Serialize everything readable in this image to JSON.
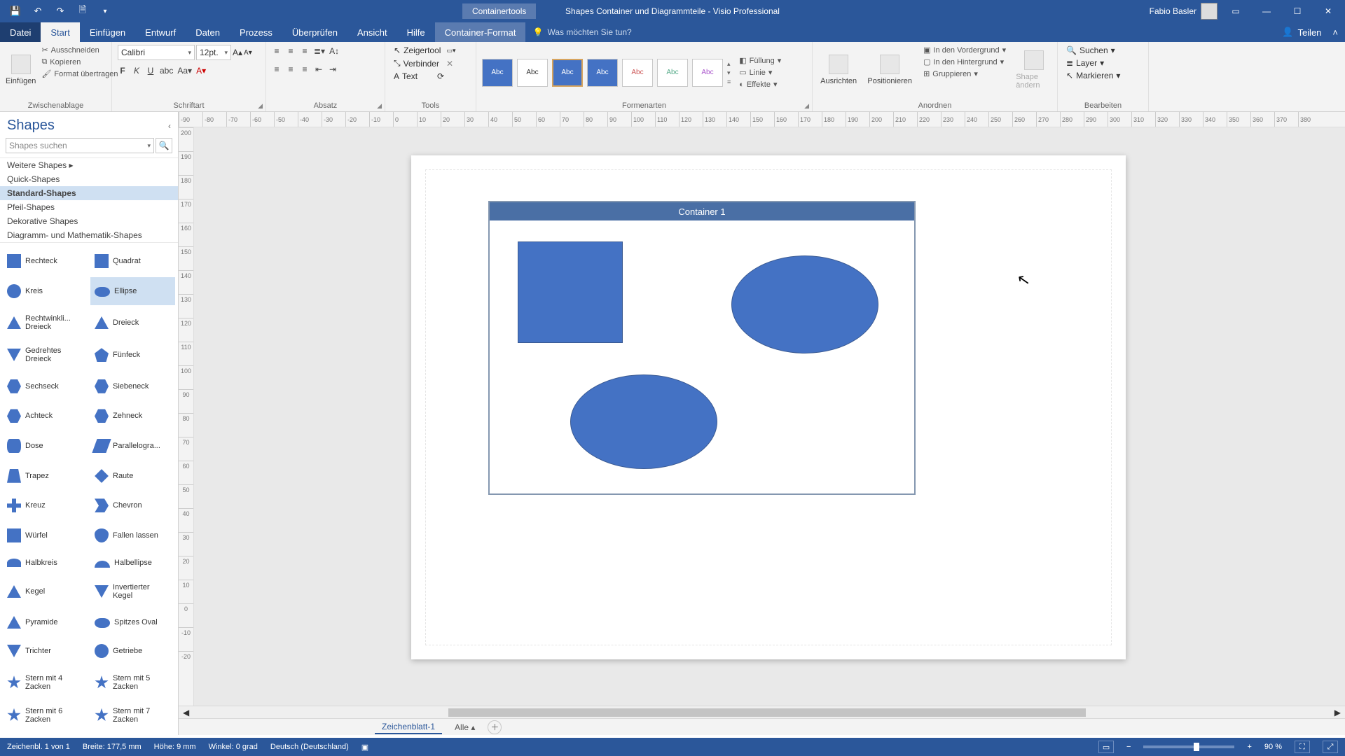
{
  "titlebar": {
    "context_tab": "Containertools",
    "doc_title": "Shapes Container und Diagrammteile  -  Visio Professional",
    "user_name": "Fabio Basler"
  },
  "tabs": {
    "datei": "Datei",
    "start": "Start",
    "einfuegen": "Einfügen",
    "entwurf": "Entwurf",
    "daten": "Daten",
    "prozess": "Prozess",
    "ueberpruefen": "Überprüfen",
    "ansicht": "Ansicht",
    "hilfe": "Hilfe",
    "container_format": "Container-Format",
    "tellme": "Was möchten Sie tun?",
    "teilen": "Teilen"
  },
  "ribbon": {
    "zwischenablage": {
      "einfuegen": "Einfügen",
      "ausschneiden": "Ausschneiden",
      "kopieren": "Kopieren",
      "format_uebertragen": "Format übertragen",
      "label": "Zwischenablage"
    },
    "schriftart": {
      "font": "Calibri",
      "size": "12pt.",
      "label": "Schriftart"
    },
    "absatz": {
      "label": "Absatz"
    },
    "tools": {
      "zeigertool": "Zeigertool",
      "verbinder": "Verbinder",
      "text": "Text",
      "label": "Tools"
    },
    "formenarten": {
      "sample": "Abc",
      "fuellung": "Füllung",
      "linie": "Linie",
      "effekte": "Effekte",
      "label": "Formenarten"
    },
    "anordnen": {
      "ausrichten": "Ausrichten",
      "positionieren": "Positionieren",
      "vordergrund": "In den Vordergrund",
      "hintergrund": "In den Hintergrund",
      "gruppieren": "Gruppieren",
      "shape_aendern": "Shape ändern",
      "layer": "Layer",
      "label": "Anordnen"
    },
    "bearbeiten": {
      "suchen": "Suchen",
      "markieren": "Markieren",
      "label": "Bearbeiten"
    }
  },
  "shapes_pane": {
    "title": "Shapes",
    "search_placeholder": "Shapes suchen",
    "categories": {
      "weitere": "Weitere Shapes",
      "quick": "Quick-Shapes",
      "standard": "Standard-Shapes",
      "pfeil": "Pfeil-Shapes",
      "dekorative": "Dekorative Shapes",
      "diagramm": "Diagramm- und Mathematik-Shapes"
    },
    "shapes": {
      "rechteck": "Rechteck",
      "quadrat": "Quadrat",
      "kreis": "Kreis",
      "ellipse": "Ellipse",
      "rechtwinkli": "Rechtwinkli... Dreieck",
      "dreieck": "Dreieck",
      "gedrehtes": "Gedrehtes Dreieck",
      "fuenfeck": "Fünfeck",
      "sechseck": "Sechseck",
      "siebeneck": "Siebeneck",
      "achteck": "Achteck",
      "zehneck": "Zehneck",
      "dose": "Dose",
      "parallelogra": "Parallelogra...",
      "trapez": "Trapez",
      "raute": "Raute",
      "kreuz": "Kreuz",
      "chevron": "Chevron",
      "wuerfel": "Würfel",
      "fallen": "Fallen lassen",
      "halbkreis": "Halbkreis",
      "halbellipse": "Halbellipse",
      "kegel": "Kegel",
      "invkegel": "Invertierter Kegel",
      "pyramide": "Pyramide",
      "spitzes": "Spitzes Oval",
      "trichter": "Trichter",
      "getriebe": "Getriebe",
      "stern4": "Stern mit 4 Zacken",
      "stern5": "Stern mit 5 Zacken",
      "stern6": "Stern mit 6 Zacken",
      "stern7": "Stern mit 7 Zacken"
    }
  },
  "h_ruler": [
    "-90",
    "-80",
    "-70",
    "-60",
    "-50",
    "-40",
    "-30",
    "-20",
    "-10",
    "0",
    "10",
    "20",
    "30",
    "40",
    "50",
    "60",
    "70",
    "80",
    "90",
    "100",
    "110",
    "120",
    "130",
    "140",
    "150",
    "160",
    "170",
    "180",
    "190",
    "200",
    "210",
    "220",
    "230",
    "240",
    "250",
    "260",
    "270",
    "280",
    "290",
    "300",
    "310",
    "320",
    "330",
    "340",
    "350",
    "360",
    "370",
    "380"
  ],
  "v_ruler": [
    "200",
    "190",
    "180",
    "170",
    "160",
    "150",
    "140",
    "130",
    "120",
    "110",
    "100",
    "90",
    "80",
    "70",
    "60",
    "50",
    "40",
    "30",
    "20",
    "10",
    "0",
    "-10",
    "-20"
  ],
  "canvas": {
    "container_title": "Container 1"
  },
  "pagetabs": {
    "sheet1": "Zeichenblatt-1",
    "alle": "Alle"
  },
  "statusbar": {
    "sheet": "Zeichenbl. 1 von 1",
    "breite": "Breite: 177,5 mm",
    "hoehe": "Höhe: 9 mm",
    "winkel": "Winkel: 0 grad",
    "lang": "Deutsch (Deutschland)",
    "zoom": "90 %"
  }
}
